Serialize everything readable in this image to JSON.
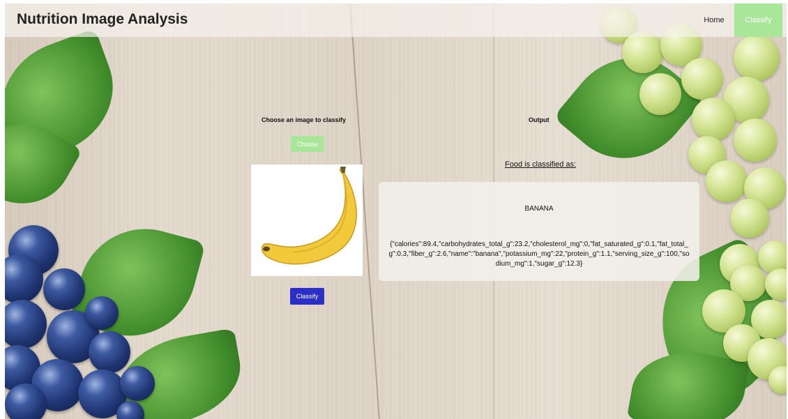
{
  "header": {
    "title": "Nutrition Image Analysis",
    "nav": {
      "home_label": "Home",
      "classify_label": "Classify"
    }
  },
  "input_panel": {
    "heading": "Choose an image to classify",
    "choose_label": "Choose",
    "classify_label": "Classify",
    "image_subject": "banana"
  },
  "output_panel": {
    "heading": "Output",
    "classified_heading": "Food is classified as:",
    "food_name": "BANANA",
    "nutrition_json": "{\"calories\":89.4,\"carbohydrates_total_g\":23.2,\"cholesterol_mg\":0,\"fat_saturated_g\":0.1,\"fat_total_g\":0.3,\"fiber_g\":2.6,\"name\":\"banana\",\"potassium_mg\":22,\"protein_g\":1.1,\"serving_size_g\":100,\"sodium_mg\":1,\"sugar_g\":12.3}"
  },
  "colors": {
    "accent_green": "#a8e69a",
    "classify_blue": "#2b2fc7",
    "banana_yellow": "#f2c93b"
  }
}
